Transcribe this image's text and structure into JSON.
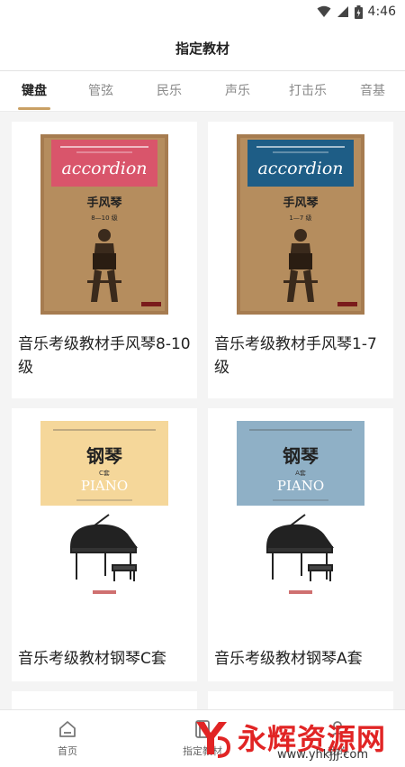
{
  "status_bar": {
    "time": "4:46"
  },
  "header": {
    "title": "指定教材"
  },
  "tabs": [
    {
      "label": "键盘",
      "active": true
    },
    {
      "label": "管弦",
      "active": false
    },
    {
      "label": "民乐",
      "active": false
    },
    {
      "label": "声乐",
      "active": false
    },
    {
      "label": "打击乐",
      "active": false
    },
    {
      "label": "音基",
      "active": false
    }
  ],
  "books": [
    {
      "title": "音乐考级教材手风琴8-10级",
      "cover_main": "accordion",
      "cover_sub": "手风琴",
      "cover_level": "8—10 级",
      "cover_band_color": "#d9556b"
    },
    {
      "title": "音乐考级教材手风琴1-7级",
      "cover_main": "accordion",
      "cover_sub": "手风琴",
      "cover_level": "1—7 级",
      "cover_band_color": "#1e5d86"
    },
    {
      "title": "音乐考级教材钢琴C套",
      "cover_main": "钢琴",
      "cover_sub": "PIANO",
      "cover_level": "C套",
      "cover_band_color": "#f5d79a"
    },
    {
      "title": "音乐考级教材钢琴A套",
      "cover_main": "钢琴",
      "cover_sub": "PIANO",
      "cover_level": "A套",
      "cover_band_color": "#8fb0c6"
    }
  ],
  "bottom_nav": [
    {
      "label": "首页",
      "icon": "home-icon"
    },
    {
      "label": "指定教材",
      "icon": "book-icon"
    },
    {
      "label": "我的",
      "icon": "user-icon"
    }
  ],
  "watermark": {
    "brand": "永辉资源网",
    "url": "www.yhkjjj.com"
  },
  "colors": {
    "accent": "#c9a064",
    "watermark_red": "#e12424"
  }
}
